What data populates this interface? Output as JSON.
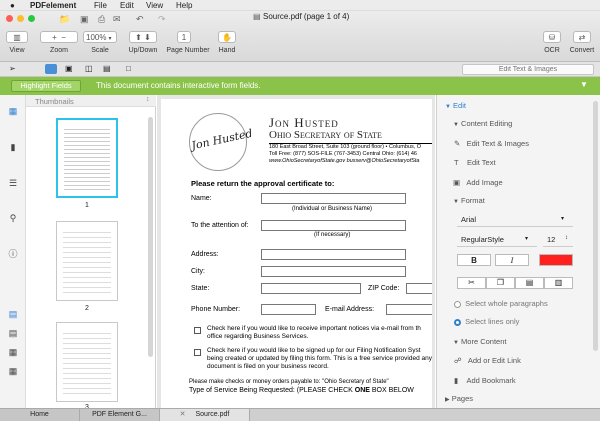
{
  "menu": {
    "apple": "",
    "app": "PDFelement",
    "file": "File",
    "edit": "Edit",
    "view": "View",
    "help": "Help"
  },
  "window_title": "Source.pdf (page 1 of 4)",
  "toolbar": {
    "view": "View",
    "zoom": "Zoom",
    "scale": "Scale",
    "zoom_value": "100%",
    "updown": "Up/Down",
    "page_number": "Page Number",
    "page_value": "1",
    "hand": "Hand",
    "ocr": "OCR",
    "convert": "Convert"
  },
  "search": {
    "placeholder": "Edit Text & Images"
  },
  "notice": {
    "button": "Highlight Fields",
    "message": "This document contains interactive form fields."
  },
  "thumbnails": {
    "header": "Thumbnails",
    "pages": [
      "1",
      "2",
      "3"
    ]
  },
  "document": {
    "seal_name": "Jon Husted",
    "title1": "Jon Husted",
    "title2": "Ohio Secretary of State",
    "addr1": "180 East Broad Street, Suite 103 (ground floor) • Columbus, O",
    "addr2": "Toll Free: (877) SOS-FILE (767-3453)   Central Ohio: (614) 46",
    "addr3": "www.OhioSecretaryofState.gov   busserv@OhioSecretaryofSta",
    "heading": "Please return the approval certificate to:",
    "name": "Name:",
    "name_hint": "(Individual or Business Name)",
    "attention": "To the attention of:",
    "attention_hint": "(If necessary)",
    "address": "Address:",
    "city": "City:",
    "state": "State:",
    "zip": "ZIP Code:",
    "phone": "Phone Number:",
    "email": "E-mail Address:",
    "check1": "Check here if you would like to receive important notices via e-mail from th office regarding Business Services.",
    "check2": "Check here if you would like to be signed up for our Filing Notification Syst being created or updated by filing this form. This is a free service provided any document is filed on your business record.",
    "payable": "Please make checks or money orders payable to: \"Ohio Secretary of State\"",
    "service_a": "Type of Service Being Requested:   (PLEASE CHECK ",
    "service_b": "ONE",
    "service_c": " BOX BELOW"
  },
  "panel": {
    "edit": "Edit",
    "content_editing": "Content Editing",
    "edit_text_images": "Edit Text & Images",
    "edit_text": "Edit Text",
    "add_image": "Add Image",
    "format": "Format",
    "font": "Arial",
    "style": "RegularStyle",
    "size": "12",
    "bold": "B",
    "italic": "I",
    "color": "#ff2020",
    "select_paragraphs": "Select whole paragraphs",
    "select_lines": "Select lines only",
    "more_content": "More Content",
    "add_link": "Add or Edit Link",
    "add_bookmark": "Add Bookmark",
    "pages": "Pages"
  },
  "tabs": {
    "home": "Home",
    "pdf_element": "PDF Element G...",
    "source": "Source.pdf"
  }
}
